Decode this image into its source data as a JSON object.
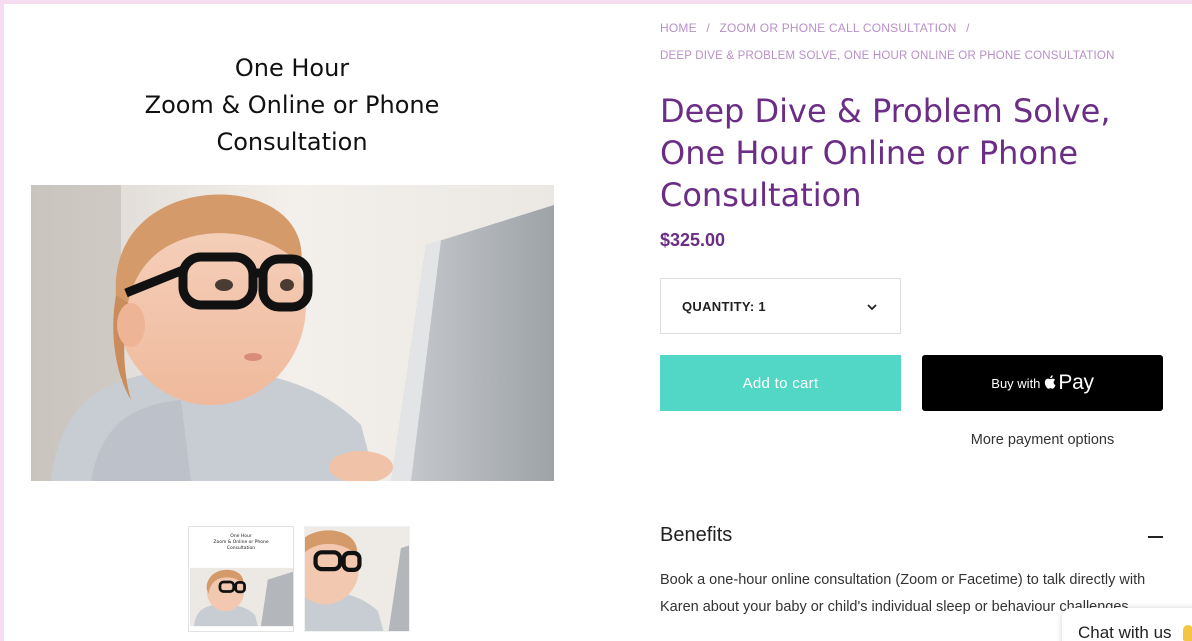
{
  "gallery": {
    "hero_title_lines": [
      "One Hour",
      "Zoom &  Online or Phone",
      "Consultation"
    ],
    "thumbnail_title_lines": [
      "One Hour",
      "Zoom &  Online or Phone",
      "Consultation"
    ]
  },
  "breadcrumb": {
    "home": "HOME",
    "separator": "/",
    "category": "ZOOM OR PHONE CALL CONSULTATION",
    "current": "DEEP DIVE & PROBLEM SOLVE, ONE HOUR ONLINE OR PHONE CONSULTATION"
  },
  "product": {
    "title": "Deep Dive & Problem Solve, One Hour Online or Phone Consultation",
    "price": "$325.00",
    "quantity_label": "QUANTITY: 1",
    "add_to_cart": "Add to cart",
    "buy_with": "Buy with",
    "pay": "Pay",
    "more_payment_options": "More payment options"
  },
  "benefits": {
    "heading": "Benefits",
    "text": "Book a one-hour online consultation (Zoom or Facetime) to talk directly with Karen about your baby or child's individual sleep or behaviour challenges."
  },
  "chat": {
    "label": "Chat with us"
  },
  "colors": {
    "brand_purple": "#6b2d86",
    "breadcrumb": "#b98fc8",
    "add_to_cart": "#52d6c6",
    "page_border": "#f6dcf0"
  },
  "icons": [
    "chevron-down-icon",
    "apple-icon",
    "collapse-minus-icon",
    "wave-hand-icon"
  ]
}
